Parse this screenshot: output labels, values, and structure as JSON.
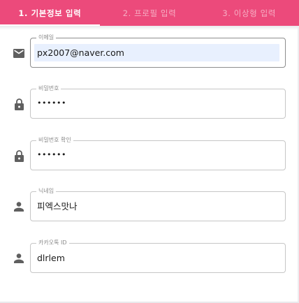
{
  "tabs": [
    {
      "label": "1. 기본정보 입력",
      "active": true
    },
    {
      "label": "2. 프로필 입력",
      "active": false
    },
    {
      "label": "3. 이상형 입력",
      "active": false
    }
  ],
  "fields": [
    {
      "label": "이메일",
      "value": "px2007@naver.com",
      "icon": "mail-icon"
    },
    {
      "label": "비밀번호",
      "value": "••••••",
      "icon": "lock-icon"
    },
    {
      "label": "비밀번호 확인",
      "value": "••••••",
      "icon": "lock-icon"
    },
    {
      "label": "닉네임",
      "value": "피엑스맛나",
      "icon": "person-icon"
    },
    {
      "label": "카카오톡 ID",
      "value": "dlrlem",
      "icon": "person-icon"
    }
  ],
  "colors": {
    "accent": "#ec4a7b",
    "icon": "#5f5f5f",
    "autofill": "#e8f0fe"
  }
}
